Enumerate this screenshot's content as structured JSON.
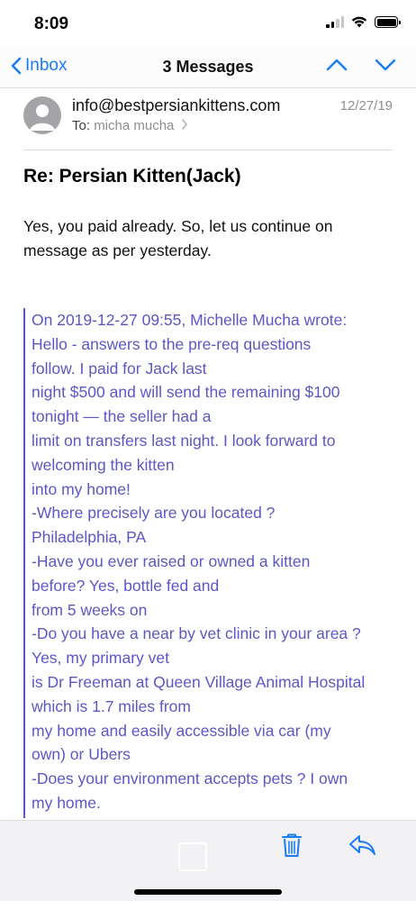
{
  "status_bar": {
    "time": "8:09",
    "icons": [
      "cellular-signal-icon",
      "wifi-icon",
      "battery-icon"
    ]
  },
  "nav": {
    "back_label": "Inbox",
    "title": "3 Messages",
    "icons": [
      "chevron-left-icon",
      "chevron-up-icon",
      "chevron-down-icon"
    ]
  },
  "header": {
    "from": "info@bestpersiankittens.com",
    "to_label": "To:",
    "to_value": "micha mucha",
    "date": "12/27/19"
  },
  "subject": "Re:  Persian Kitten(Jack)",
  "body": {
    "line1": "Yes, you paid already. So, let us continue on",
    "line2": "message as per yesterday."
  },
  "quote_lines": [
    "On 2019-12-27 09:55, Michelle Mucha wrote:",
    "Hello - answers to the pre-req questions",
    "follow.  I paid for Jack last",
    "night $500 and will send the remaining $100",
    "tonight — the seller had a",
    "limit on transfers last night.  I look forward to",
    "welcoming the kitten",
    "into my home!",
    "-Where precisely are you located ?",
    "Philadelphia, PA",
    "-Have you ever raised or owned a kitten",
    "before? Yes, bottle fed and",
    "from 5 weeks on",
    "-Do you have a near by vet clinic in your area ?",
    "Yes, my primary vet",
    "is Dr Freeman at Queen Village Animal Hospital",
    "which is 1.7 miles from",
    "my home and easily accessible via car (my",
    "own) or Ubers",
    "-Does your environment accepts pets ? I own",
    "my home."
  ],
  "toolbar": {
    "icons": [
      "trash-icon",
      "reply-icon"
    ]
  },
  "colors": {
    "accent": "#1a7cf6",
    "quote": "#5b57c7"
  }
}
